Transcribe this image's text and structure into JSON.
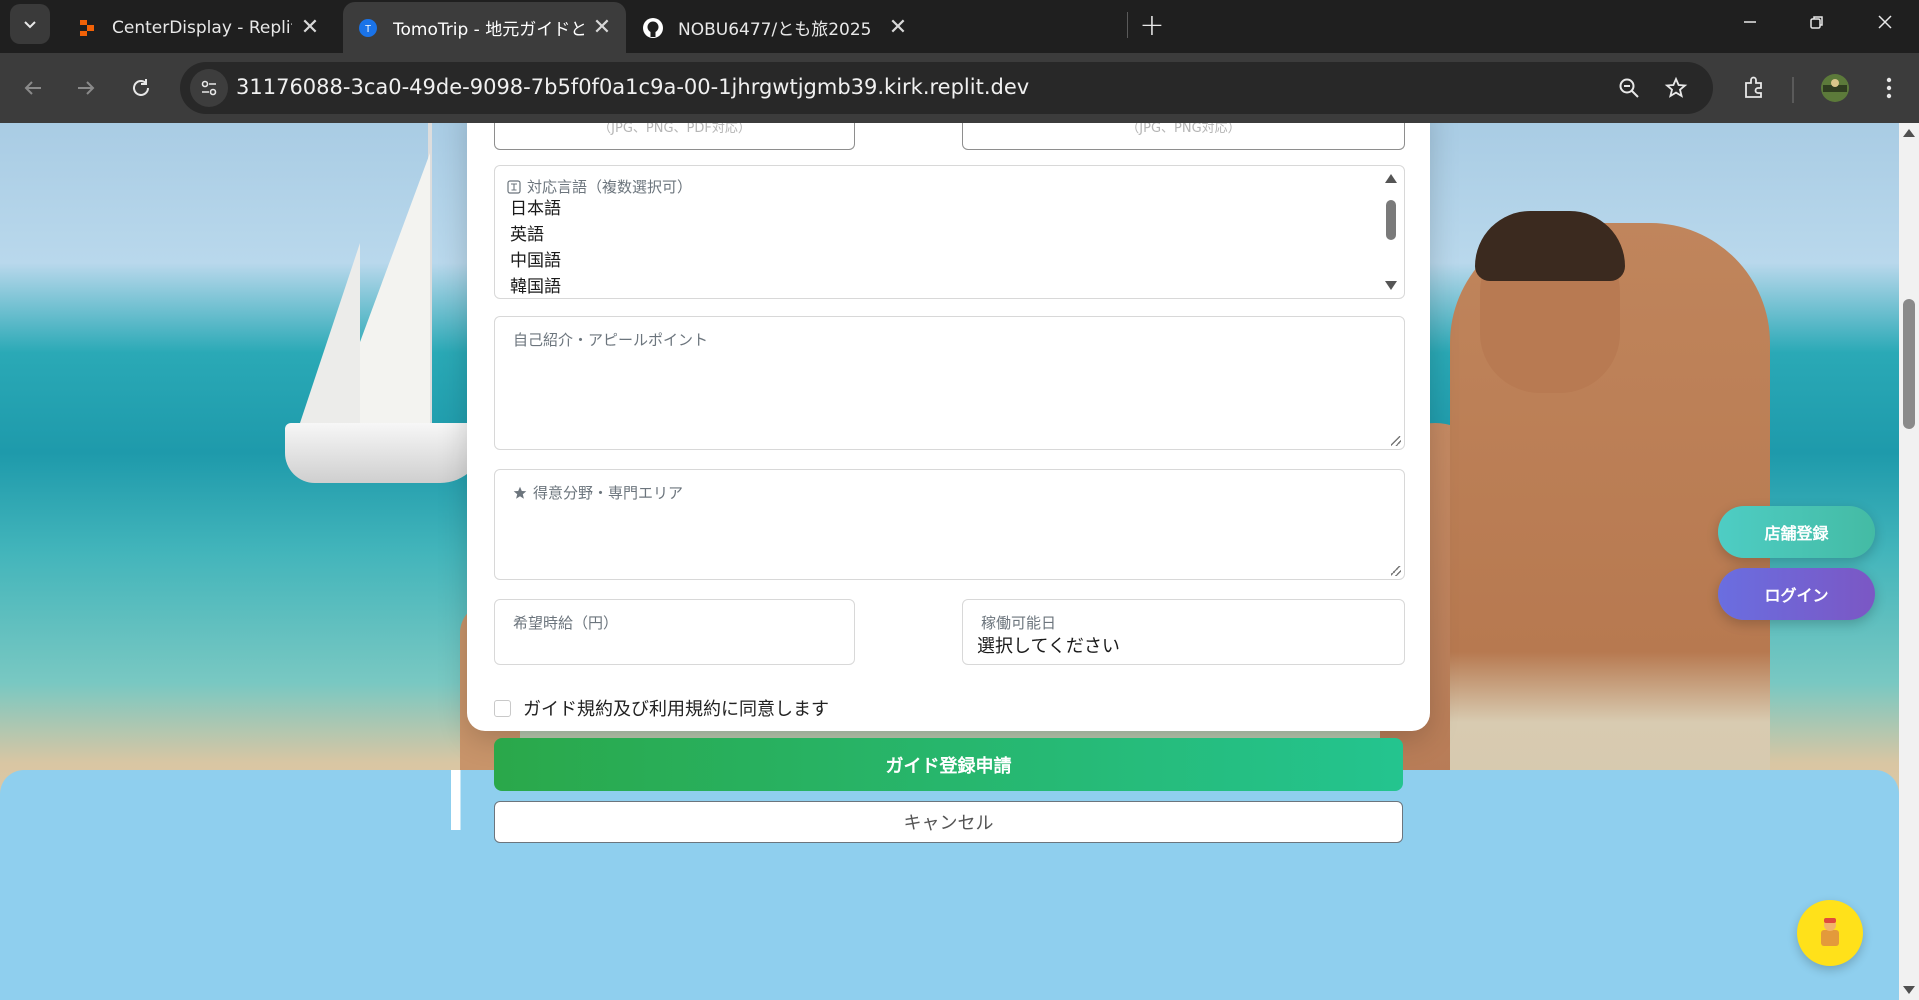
{
  "browser": {
    "tabs": [
      {
        "title": "CenterDisplay - Replit",
        "favicon": "replit-icon",
        "active": false
      },
      {
        "title": "TomoTrip - 地元ガイドと特別な旅",
        "favicon": "tomotrip-icon",
        "active": true
      },
      {
        "title": "NOBU6477/とも旅2025",
        "favicon": "github-icon",
        "active": false
      }
    ],
    "url": "31176088-3ca0-49de-9098-7b5f0f0a1c9a-00-1jhrgwtjgmb39.kirk.replit.dev",
    "tomotrip_favicon_letter": "T"
  },
  "form": {
    "top_left_hint": "（JPG、PNG、PDF対応）",
    "top_right_hint": "（JPG、PNG対応）",
    "languages": {
      "label": "対応言語（複数選択可）",
      "options": [
        "日本語",
        "英語",
        "中国語",
        "韓国語"
      ]
    },
    "intro": {
      "label": "自己紹介・アピールポイント",
      "value": ""
    },
    "specialty": {
      "label": "得意分野・専門エリア",
      "value": ""
    },
    "hourly_rate": {
      "label": "希望時給（円）",
      "value": ""
    },
    "availability": {
      "label": "稼働可能日",
      "value": "選択してください"
    },
    "agree_label": "ガイド規約及び利用規約に同意します",
    "agree_checked": false,
    "submit_label": "ガイド登録申請",
    "cancel_label": "キャンセル"
  },
  "floating": {
    "store_register": "店舗登録",
    "login": "ログイン"
  },
  "colors": {
    "submit_start": "#2aa84a",
    "submit_end": "#24c48f",
    "store_button": "#4ecdc4",
    "login_button": "#6a6ee0",
    "chat_button": "#ffe11a"
  }
}
